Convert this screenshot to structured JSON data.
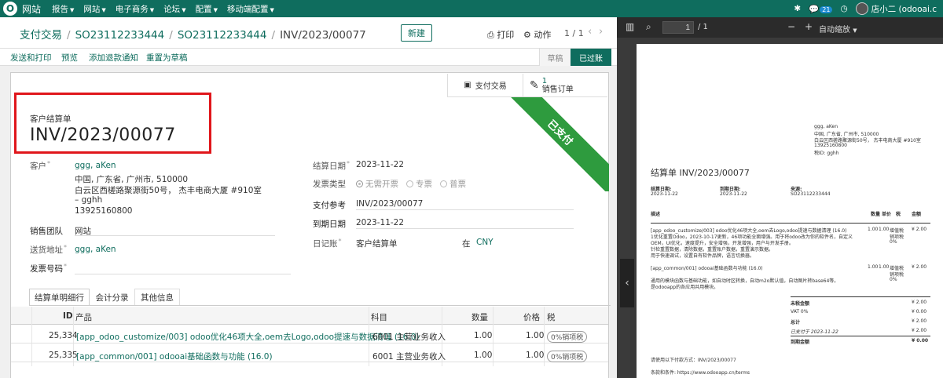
{
  "topnav": {
    "app": "网站",
    "menus": [
      "报告",
      "网站",
      "电子商务",
      "论坛",
      "配置",
      "移动端配置"
    ],
    "msg_count": "21",
    "user": "店小二 (odooai.c"
  },
  "breadcrumb": {
    "items": [
      "支付交易",
      "SO23112233444",
      "SO23112233444"
    ],
    "current": "INV/2023/00077"
  },
  "toolbar": {
    "new_label": "新建",
    "print_label": "打印",
    "action_label": "动作",
    "pager": "1 / 1"
  },
  "status_actions": [
    "发送和打印",
    "预览",
    "添加退款通知",
    "重置为草稿"
  ],
  "status": {
    "draft": "草稿",
    "posted": "已过账"
  },
  "smart": {
    "payment": "支付交易",
    "so_count": "1",
    "so_label": "销售订单"
  },
  "ribbon": "已支付",
  "doc": {
    "type": "客户结算单",
    "number": "INV/2023/00077"
  },
  "left_fields": {
    "customer_label": "客户",
    "customer_name": "ggg, aKen",
    "addr1": "中国, 广东省, 广州市, 510000",
    "addr2": "白云区西槎路聚源街50号， 杰丰电商大厦 #910室",
    "addr3": "– gghh",
    "addr4": "13925160800",
    "team_label": "销售团队",
    "team_value": "网站",
    "shipping_label": "送货地址",
    "shipping_value": "ggg, aKen",
    "invoice_no_label": "发票号码"
  },
  "right_fields": {
    "date_label": "结算日期",
    "date_value": "2023-11-22",
    "inv_type_label": "发票类型",
    "inv_type_opts": [
      "无需开票",
      "专票",
      "普票"
    ],
    "payref_label": "支付参考",
    "payref_value": "INV/2023/00077",
    "due_label": "到期日期",
    "due_value": "2023-11-22",
    "journal_label": "日记账",
    "journal_value": "客户结算单",
    "in_label": "在",
    "currency": "CNY"
  },
  "tabs": [
    "结算单明细行",
    "会计分录",
    "其他信息"
  ],
  "lines": {
    "headers": [
      "ID",
      "产品",
      "科目",
      "数量",
      "价格",
      "税"
    ],
    "rows": [
      {
        "id": "25,334",
        "product": "[app_odoo_customize/003] odoo优化46项大全,oem去Logo,odoo提速与数据清理 (16.0)",
        "account": "6001 主营业务收入",
        "qty": "1.00",
        "price": "1.00",
        "tax": "0%销项税"
      },
      {
        "id": "25,335",
        "product": "[app_common/001] odooai基础函数与功能 (16.0)",
        "account": "6001 主营业务收入",
        "qty": "1.00",
        "price": "1.00",
        "tax": "0%销项税"
      }
    ]
  },
  "pdf": {
    "page_input": "1",
    "page_total": "/ 1",
    "zoom": "自动缩放",
    "addr": [
      "ggg, aKen",
      "中国, 广东省, 广州市, 510000",
      "白云区西槎路聚源街50号， 杰丰电商大厦 #910室",
      "13925160800",
      "税ID: gghh"
    ],
    "title": "结算单 INV/2023/00077",
    "meta_labels": [
      "结算日期:",
      "到期日期:",
      "来源:"
    ],
    "meta_values": [
      "2023-11-22",
      "2023-11-22",
      "SO23112233444"
    ],
    "table_headers": [
      "描述",
      "数量",
      "单价",
      "税",
      "金额"
    ],
    "line1": [
      "[app_odoo_customize/003] odoo优化46项大全,oem去Logo,odoo提速与数据清理 (16.0)",
      "1优化重置Odoo，2023-10-17更新，46项功能全面增强。用于将odoo改为你的软件名，自定义",
      "OEM，UI优化，速度提升，安全增强，开发增强，用户与开发手册。",
      "针检重置数据，清除数据，重置账户数据，重置演示数据。",
      "用于快速调试，设置自有软件品牌，语言切换器。"
    ],
    "line1_nums": [
      "1.00",
      "1.00",
      "¥ 2.00"
    ],
    "line1_tax": [
      "增值税",
      "销项税",
      "0%"
    ],
    "line2": [
      "[app_common/001] odooai基础函数与功能 (16.0)",
      "",
      "通用的模块函数与基础功能，如自动时区转换，自动m2o默认值，自动图片转base64等。",
      "是odooapp的各应用共用模块。"
    ],
    "line2_nums": [
      "1.00",
      "1.00",
      "¥ 2.00"
    ],
    "line2_tax": [
      "增值税",
      "销项税",
      "0%"
    ],
    "totals": [
      [
        "未税金额",
        "¥ 2.00"
      ],
      [
        "VAT 0%",
        "¥ 0.00"
      ],
      [
        "总计",
        "¥ 2.00"
      ],
      [
        "已支付于 2023-11-22",
        "¥ 2.00"
      ],
      [
        "到期金额",
        "¥ 0.00"
      ]
    ],
    "pay_note": "请使用以下付款方式：INV/2023/00077",
    "terms": "条款和条件: https://www.odooapp.cn/terms"
  }
}
